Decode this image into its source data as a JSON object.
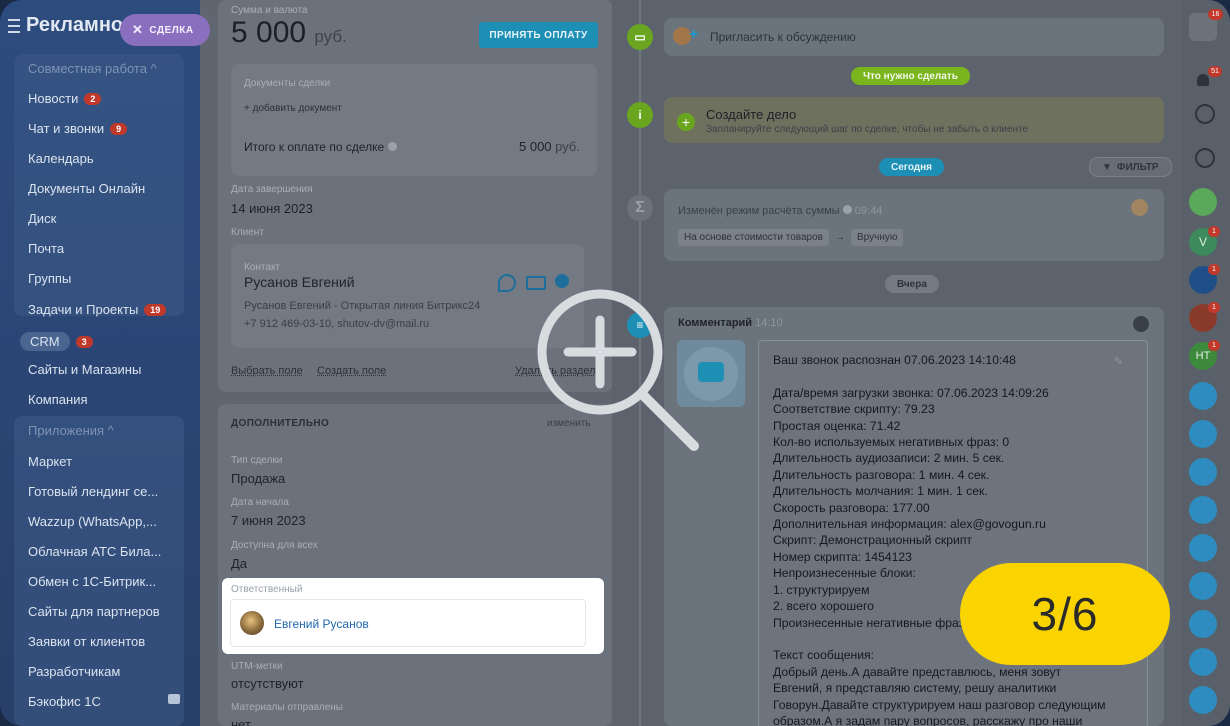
{
  "sidebar": {
    "brand": "Рекламно",
    "deal_pill": "СДЕЛКА",
    "section_joint": "Совместная работа ^",
    "items": [
      {
        "label": "Новости",
        "badge": "2"
      },
      {
        "label": "Чат и звонки",
        "badge": "9"
      },
      {
        "label": "Календарь"
      },
      {
        "label": "Документы Онлайн"
      },
      {
        "label": "Диск"
      },
      {
        "label": "Почта"
      },
      {
        "label": "Группы"
      },
      {
        "label": "Задачи и Проекты",
        "badge": "19"
      },
      {
        "label": "CRM",
        "badge": "3"
      },
      {
        "label": "Сайты и Магазины"
      },
      {
        "label": "Компания"
      }
    ],
    "section_apps": "Приложения ^",
    "apps": [
      "Маркет",
      "Готовый лендинг се...",
      "Wazzup (WhatsApp,...",
      "Облачная АТС Била...",
      "Обмен с 1С-Битрик...",
      "Сайты для партнеров",
      "Заявки от клиентов",
      "Разработчикам",
      "Бэкофис 1С"
    ]
  },
  "deal": {
    "amount_label": "Сумма и валюта",
    "amount": "5 000",
    "currency": "руб.",
    "pay_button": "ПРИНЯТЬ ОПЛАТУ",
    "documents_label": "Документы сделки",
    "add_document": "+ добавить документ",
    "total_label": "Итого к оплате по сделке",
    "total_value": "5 000",
    "total_currency": "руб.",
    "close_date_label": "Дата завершения",
    "close_date": "14 июня 2023",
    "client_label": "Клиент",
    "contact_label": "Контакт",
    "contact_name": "Русанов Евгений",
    "contact_source": "Русанов Евгений - Открытая линия Битрикс24",
    "contact_details": "+7 912 469-03-10, shutov-dv@mail.ru",
    "choose_field": "Выбрать поле",
    "create_field": "Создать поле",
    "delete_section": "Удалить раздел"
  },
  "additional": {
    "title": "ДОПОЛНИТЕЛЬНО",
    "edit": "изменить",
    "type_label": "Тип сделки",
    "type_value": "Продажа",
    "start_label": "Дата начала",
    "start_value": "7 июня 2023",
    "access_label": "Доступна для всех",
    "access_value": "Да",
    "responsible_label": "Ответственный",
    "responsible_name": "Евгений Русанов",
    "utm_label": "UTM-метки",
    "utm_value": "отсутствуют",
    "materials_label": "Материалы отправлены",
    "materials_value": "нет"
  },
  "timeline": {
    "invite": "Пригласить к обсуждению",
    "todo_pill": "Что нужно сделать",
    "task_title": "Создайте дело",
    "task_hint": "Запланируйте следующий шаг по сделке, чтобы не забыть о клиенте",
    "today_pill": "Сегодня",
    "filter": "ФИЛЬТР",
    "change_title": "Изменён режим расчёта суммы",
    "change_time": "09:44",
    "change_from": "На основе стоимости товаров",
    "change_arrow": "→",
    "change_to": "Вручную",
    "yesterday_pill": "Вчера",
    "comment_title": "Комментарий",
    "comment_time": "14:10",
    "comment_lines": [
      "Ваш звонок распознан 07.06.2023 14:10:48",
      "",
      "Дата/время загрузки звонка: 07.06.2023 14:09:26",
      "Соответствие скрипту: 79.23",
      "Простая оценка: 71.42",
      "Кол-во используемых негативных фраз: 0",
      "Длительность аудиозаписи: 2 мин. 5 сек.",
      "Длительность разговора: 1 мин. 4 сек.",
      "Длительность молчания: 1 мин. 1 сек.",
      "Скорость разговора: 177.00",
      "Дополнительная информация: alex@govogun.ru",
      "Скрипт: Демонстрационный скрипт",
      "Номер скрипта: 1454123",
      "Непроизнесенные блоки:",
      "1. структурируем",
      "2. всего хорошего",
      "Произнесенные негативные фраз",
      "",
      "Текст сообщения:",
      "Добрый день.А давайте представлюсь, меня зовут",
      "Евгений, я представляю систему, решу аналитики",
      "Говорун.Давайте структурируем наш разговор следующим",
      "образом.А я задам пару вопросов, расскажу про наши"
    ]
  },
  "right_strip": {
    "help_badge": "16",
    "bell_badge": "51",
    "avatar_v": "V",
    "avatar_nt": "НТ",
    "small_badge": "1"
  },
  "counter": "3/6",
  "colors": {
    "accent_blue": "#1d8fb5",
    "green": "#6aa51f",
    "counter_yellow": "#f9d400",
    "badge_red": "#c0392b"
  }
}
